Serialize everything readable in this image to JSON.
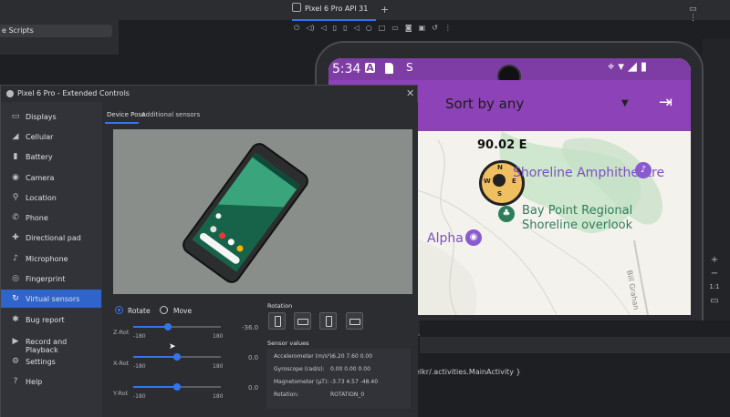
{
  "ide": {
    "left_panel_item": "e Scripts",
    "emulator_tab": "Pixel 6 Pro API 31",
    "console_line": "elkr/.activities.MainActivity }",
    "zoom_controls": [
      "+",
      "−",
      "1:1",
      "▭"
    ]
  },
  "phone": {
    "status": {
      "time": "5:34",
      "a_badge": "A",
      "s_icon": "S",
      "right_icons": "⌖▾◢▮"
    },
    "app_bar": {
      "sort_label": "Sort by any",
      "dropdown_icon": "▼",
      "exit_icon": "⇥"
    },
    "map": {
      "bearing": "90.02  E",
      "compass_letters": {
        "n": "N",
        "e": "E",
        "s": "S",
        "w": "W"
      },
      "poi_1": "Shoreline Amphitheatre",
      "poi_2_line1": "Bay Point Regional",
      "poi_2_line2": "Shoreline overlook",
      "poi_3": "Alpha",
      "street": "Bill Grahan"
    }
  },
  "dialog": {
    "title": "Pixel 6 Pro - Extended Controls",
    "close": "✕",
    "nav": [
      {
        "label": "Displays",
        "icon": "▭"
      },
      {
        "label": "Cellular",
        "icon": "◢"
      },
      {
        "label": "Battery",
        "icon": "▮"
      },
      {
        "label": "Camera",
        "icon": "◉"
      },
      {
        "label": "Location",
        "icon": "⚲"
      },
      {
        "label": "Phone",
        "icon": "✆"
      },
      {
        "label": "Directional pad",
        "icon": "✚"
      },
      {
        "label": "Microphone",
        "icon": "♪"
      },
      {
        "label": "Fingerprint",
        "icon": "◎"
      },
      {
        "label": "Virtual sensors",
        "icon": "↻"
      },
      {
        "label": "Bug report",
        "icon": "✱"
      },
      {
        "label": "Record and Playback",
        "icon": "▶"
      },
      {
        "label": "Settings",
        "icon": "⚙"
      },
      {
        "label": "Help",
        "icon": "?"
      }
    ],
    "active_nav": "Virtual sensors",
    "tabs": {
      "pose": "Device Pose",
      "additional": "Additional sensors"
    },
    "mode": {
      "rotate": "Rotate",
      "move": "Move",
      "selected": "Rotate"
    },
    "sliders": [
      {
        "label": "Z-Rot",
        "min": "-180",
        "max": "180",
        "value": "-36.0",
        "fraction": 0.4
      },
      {
        "label": "X-Rot",
        "min": "-180",
        "max": "180",
        "value": "0.0",
        "fraction": 0.5
      },
      {
        "label": "Y-Rot",
        "min": "-180",
        "max": "180",
        "value": "0.0",
        "fraction": 0.5
      }
    ],
    "rotation_label": "Rotation",
    "sensor_values_label": "Sensor values",
    "sensor_values": [
      {
        "name": "Accelerometer (m/s²):",
        "value": "-6.20  7.60  0.00"
      },
      {
        "name": "Gyroscope (rad/s):",
        "value": "0.00   0.00  0.00"
      },
      {
        "name": "Magnetometer (µT):",
        "value": "-3.73  4.57  -48.40"
      },
      {
        "name": "Rotation:",
        "value": "ROTATION_0"
      }
    ]
  },
  "colors": {
    "accent": "#3574f0",
    "app_bar": "#8e42b8",
    "status_bar": "#7e3ca5",
    "active_nav": "#2f65ca"
  }
}
